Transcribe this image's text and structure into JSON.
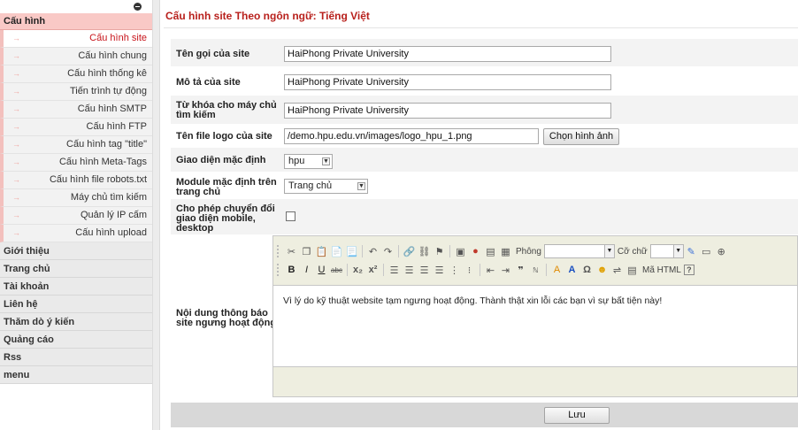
{
  "sidebar": {
    "section_title": "Cấu hình",
    "sub_items": [
      {
        "label": "Cấu hình site",
        "active": true
      },
      {
        "label": "Cấu hình chung"
      },
      {
        "label": "Cấu hình thống kê"
      },
      {
        "label": "Tiến trình tự động"
      },
      {
        "label": "Cấu hình SMTP"
      },
      {
        "label": "Cấu hình FTP"
      },
      {
        "label": "Cấu hình tag \"title\""
      },
      {
        "label": "Cấu hình Meta-Tags"
      },
      {
        "label": "Cấu hình file robots.txt"
      },
      {
        "label": "Máy chủ tìm kiếm"
      },
      {
        "label": "Quản lý IP cấm"
      },
      {
        "label": "Cấu hình upload"
      }
    ],
    "main_items": [
      "Giới thiệu",
      "Trang chủ",
      "Tài khoản",
      "Liên hệ",
      "Thăm dò ý kiến",
      "Quảng cáo",
      "Rss",
      "menu"
    ]
  },
  "page_title": "Cấu hình site Theo ngôn ngữ: Tiếng Việt",
  "form": {
    "site_name": {
      "label": "Tên gọi của site",
      "value": "HaiPhong Private University"
    },
    "site_desc": {
      "label": "Mô tả của site",
      "value": "HaiPhong Private University"
    },
    "keywords": {
      "label": "Từ khóa cho máy chủ tìm kiếm",
      "value": "HaiPhong Private University"
    },
    "logo": {
      "label": "Tên file logo của site",
      "value": "/demo.hpu.edu.vn/images/logo_hpu_1.png",
      "button": "Chọn hình ảnh"
    },
    "theme": {
      "label": "Giao diện mặc định",
      "value": "hpu"
    },
    "module": {
      "label": "Module mặc định trên trang chủ",
      "value": "Trang chủ"
    },
    "mobile_switch": {
      "label": "Cho phép chuyển đổi giao diện mobile, desktop",
      "checked": false
    },
    "closed_msg": {
      "label": "Nội dung thông báo site ngưng hoạt động",
      "content": "Vì lý do kỹ thuật website tạm ngưng hoạt động. Thành thật xin lỗi các bạn vì sự bất tiện này!",
      "toolbar": {
        "font_label": "Phông",
        "size_label": "Cỡ chữ",
        "source_label": "Mã HTML"
      }
    }
  },
  "save_label": "Lưu"
}
